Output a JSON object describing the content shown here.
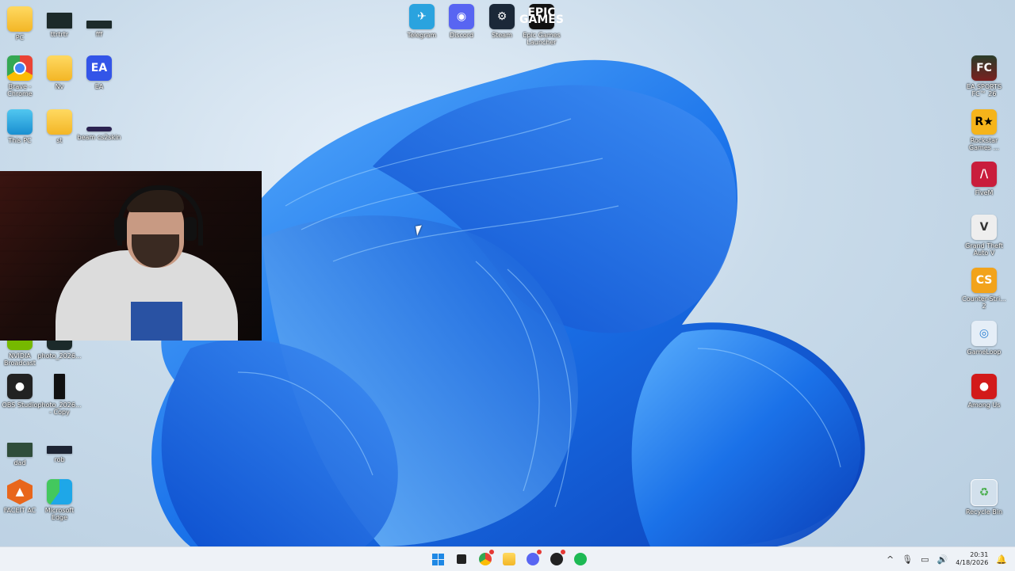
{
  "desktop": {
    "left_icons": [
      {
        "label": "PC",
        "icon": "folder-icon"
      },
      {
        "label": "ttrtrtr",
        "icon": "image-thumb-icon"
      },
      {
        "label": "fff",
        "icon": "image-thumb-icon"
      },
      {
        "label": "Brave - Chrome",
        "icon": "chrome-icon"
      },
      {
        "label": "Nv",
        "icon": "folder-icon"
      },
      {
        "label": "EA",
        "icon": "ea-icon"
      },
      {
        "label": "This PC",
        "icon": "monitor-icon"
      },
      {
        "label": "st",
        "icon": "folder-icon"
      },
      {
        "label": "beam cs2skin",
        "icon": "image-thumb-icon"
      },
      {
        "label": "NVIDIA Broadcast",
        "icon": "nvidia-icon"
      },
      {
        "label": "photo_2026...",
        "icon": "image-thumb-icon"
      },
      {
        "label": "OBS Studio",
        "icon": "obs-icon"
      },
      {
        "label": "photo_2026... - Copy",
        "icon": "image-thumb-icon"
      },
      {
        "label": "dad",
        "icon": "image-thumb-icon"
      },
      {
        "label": "rob",
        "icon": "image-thumb-icon"
      },
      {
        "label": "FACEIT AC",
        "icon": "faceit-icon"
      },
      {
        "label": "Microsoft Edge",
        "icon": "edge-icon"
      }
    ],
    "top_icons": [
      {
        "label": "Telegram",
        "icon": "telegram-icon",
        "glyph": "✈"
      },
      {
        "label": "Discord",
        "icon": "discord-icon",
        "glyph": "◉"
      },
      {
        "label": "Steam",
        "icon": "steam-icon",
        "glyph": "⚙"
      },
      {
        "label": "Epic Games Launcher",
        "icon": "epic-icon",
        "glyph": "EPIC GAMES"
      }
    ],
    "right_icons": [
      {
        "label": "EA SPORTS FC™ 26",
        "icon": "fc26-icon",
        "glyph": "FC"
      },
      {
        "label": "Rockstar Games ...",
        "icon": "rockstar-icon",
        "glyph": "R★"
      },
      {
        "label": "FiveM",
        "icon": "fivem-icon",
        "glyph": "/\\"
      },
      {
        "label": "Grand Theft Auto V",
        "icon": "gta-icon",
        "glyph": "V"
      },
      {
        "label": "Counter-Stri... 2",
        "icon": "cs2-icon",
        "glyph": "CS"
      },
      {
        "label": "GameLoop",
        "icon": "gameloop-icon",
        "glyph": "◎"
      },
      {
        "label": "Among Us",
        "icon": "amongus-icon",
        "glyph": "●"
      },
      {
        "label": "Recycle Bin",
        "icon": "recycle-bin-icon",
        "glyph": "♻"
      }
    ],
    "ea_glyph": "EA"
  },
  "taskbar": {
    "apps": [
      "start",
      "task-view",
      "chrome",
      "file-explorer",
      "discord",
      "obs",
      "spotify"
    ],
    "tray": {
      "chevron": "^",
      "time": "20:31",
      "date": "4/18/2026"
    }
  },
  "colors": {
    "accent": "#1e88e5",
    "wallpaper_blue": "#0a62e0"
  }
}
